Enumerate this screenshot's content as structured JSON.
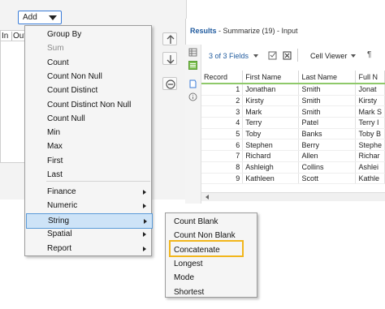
{
  "config": {
    "add_label": "Add",
    "grid_headers": [
      "In",
      "Out"
    ]
  },
  "results": {
    "title_prefix": "Results",
    "title_suffix": " - Summarize (19) - Input",
    "fields_label": "3 of 3 Fields",
    "cell_viewer_label": "Cell Viewer",
    "columns": [
      "Record",
      "First Name",
      "Last Name",
      "Full N"
    ],
    "rows": [
      [
        "1",
        "Jonathan",
        "Smith",
        "Jonat"
      ],
      [
        "2",
        "Kirsty",
        "Smith",
        "Kirsty"
      ],
      [
        "3",
        "Mark",
        "Smith",
        "Mark S"
      ],
      [
        "4",
        "Terry",
        "Patel",
        "Terry I"
      ],
      [
        "5",
        "Toby",
        "Banks",
        "Toby B"
      ],
      [
        "6",
        "Stephen",
        "Berry",
        "Stephe"
      ],
      [
        "7",
        "Richard",
        "Allen",
        "Richar"
      ],
      [
        "8",
        "Ashleigh",
        "Collins",
        "Ashlei"
      ],
      [
        "9",
        "Kathleen",
        "Scott",
        "Kathle"
      ]
    ]
  },
  "menu": {
    "items": [
      {
        "label": "Group By",
        "disabled": false
      },
      {
        "label": "Sum",
        "disabled": true
      },
      {
        "label": "Count",
        "disabled": false
      },
      {
        "label": "Count Non Null",
        "disabled": false
      },
      {
        "label": "Count Distinct",
        "disabled": false
      },
      {
        "label": "Count Distinct Non Null",
        "disabled": false
      },
      {
        "label": "Count Null",
        "disabled": false
      },
      {
        "label": "Min",
        "disabled": false
      },
      {
        "label": "Max",
        "disabled": false
      },
      {
        "label": "First",
        "disabled": false
      },
      {
        "label": "Last",
        "disabled": false
      }
    ],
    "submenus": [
      "Finance",
      "Numeric",
      "String",
      "Spatial",
      "Report"
    ],
    "highlighted": "String"
  },
  "submenu": {
    "items": [
      "Count Blank",
      "Count Non Blank",
      "Concatenate",
      "Longest",
      "Mode",
      "Shortest"
    ],
    "callout_item": "Concatenate",
    "callout_color": "#f2b61c"
  },
  "colors": {
    "accent": "#3b7dd8",
    "highlight": "#cde3f7",
    "header_underline": "#8fc96a"
  }
}
